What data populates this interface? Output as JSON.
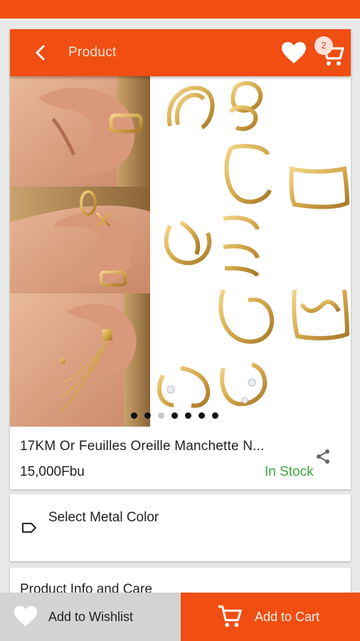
{
  "app_bar": {
    "title": "Product",
    "cart_count": "2",
    "back_icon": "back-arrow-icon",
    "wishlist_icon": "heart-icon",
    "cart_icon": "cart-icon"
  },
  "product": {
    "name": "17KM Or Feuilles Oreille Manchette N...",
    "price": "15,000Fbu",
    "stock_status": "In Stock",
    "image_count": 7,
    "active_image": 3,
    "share_icon": "share-icon"
  },
  "options": {
    "metal_color_label": "Select Metal Color",
    "tag_icon": "tag-icon"
  },
  "info": {
    "label": "Product Info and Care"
  },
  "bottom": {
    "wishlist_label": "Add to Wishlist",
    "cart_label": "Add to Cart"
  },
  "colors": {
    "accent": "#f04e12",
    "in_stock": "#3aa63a",
    "gold": "#d4a94b"
  }
}
